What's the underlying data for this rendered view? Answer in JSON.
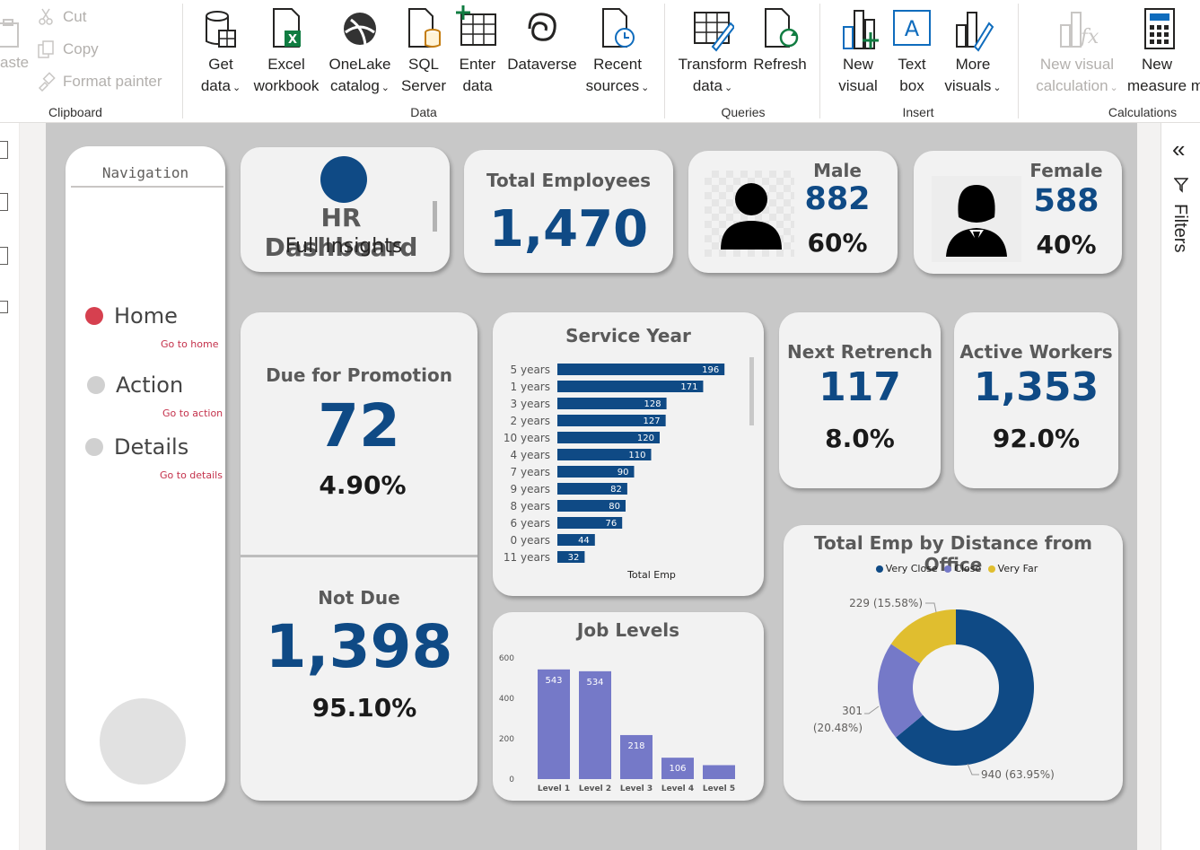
{
  "ribbon": {
    "clipboard": {
      "paste": "aste",
      "cut": "Cut",
      "copy": "Copy",
      "format_painter": "Format painter",
      "group": "Clipboard"
    },
    "data": {
      "group": "Data",
      "get_data": [
        "Get",
        "data"
      ],
      "excel": [
        "Excel",
        "workbook"
      ],
      "onelake": [
        "OneLake",
        "catalog"
      ],
      "sql": [
        "SQL",
        "Server"
      ],
      "enter": [
        "Enter",
        "data"
      ],
      "dataverse": "Dataverse",
      "recent": [
        "Recent",
        "sources"
      ]
    },
    "queries": {
      "group": "Queries",
      "transform": [
        "Transform",
        "data"
      ],
      "refresh": "Refresh"
    },
    "insert": {
      "group": "Insert",
      "new_visual": [
        "New",
        "visual"
      ],
      "text_box": [
        "Text",
        "box"
      ],
      "more_visuals": [
        "More",
        "visuals"
      ]
    },
    "calculations": {
      "group": "Calculations",
      "new_visual_calc": [
        "New visual",
        "calculation"
      ],
      "new_measure": [
        "New",
        "measure m"
      ]
    }
  },
  "filters_pane": {
    "collapse": "«",
    "label": "Filters"
  },
  "navigation": {
    "title": "Navigation",
    "items": [
      {
        "label": "Home",
        "sub": "Go to home"
      },
      {
        "label": "Action",
        "sub": "Go to action"
      },
      {
        "label": "Details",
        "sub": "Go to details"
      }
    ]
  },
  "header_card": {
    "title": "HR Dashboard",
    "subtitle": "Full Insights"
  },
  "total_employees": {
    "title": "Total Employees",
    "value": "1,470"
  },
  "male": {
    "title": "Male",
    "value": "882",
    "pct": "60%"
  },
  "female": {
    "title": "Female",
    "value": "588",
    "pct": "40%"
  },
  "promotion": {
    "title": "Due for Promotion",
    "value": "72",
    "pct": "4.90%"
  },
  "not_due": {
    "title": "Not Due",
    "value": "1,398",
    "pct": "95.10%"
  },
  "retrench": {
    "title": "Next Retrench",
    "value": "117",
    "pct": "8.0%"
  },
  "active": {
    "title": "Active Workers",
    "value": "1,353",
    "pct": "92.0%"
  },
  "colors": {
    "accent": "#0f4a85",
    "bar": "#0f4a85",
    "jobbar": "#7579c8",
    "very_close": "#0f4a85",
    "close": "#7579c8",
    "very_far": "#e0be2f",
    "nav_active": "#d6404f"
  },
  "chart_data": [
    {
      "type": "bar",
      "orientation": "horizontal",
      "title": "Service Year",
      "xlabel": "Total Emp",
      "categories": [
        "5 years",
        "1 years",
        "3 years",
        "2 years",
        "10 years",
        "4 years",
        "7 years",
        "9 years",
        "8 years",
        "6 years",
        "0 years",
        "11 years"
      ],
      "values": [
        196,
        171,
        128,
        127,
        120,
        110,
        90,
        82,
        80,
        76,
        44,
        32
      ],
      "xlim": [
        0,
        200
      ]
    },
    {
      "type": "bar",
      "title": "Job Levels",
      "categories": [
        "Level 1",
        "Level 2",
        "Level 3",
        "Level 4",
        "Level 5"
      ],
      "values": [
        543,
        534,
        218,
        106,
        69
      ],
      "data_labels": [
        "543",
        "534",
        "218",
        "106",
        ""
      ],
      "yticks": [
        "0",
        "200",
        "400",
        "600"
      ],
      "ylim": [
        0,
        600
      ]
    },
    {
      "type": "pie",
      "donut": true,
      "title": "Total Emp by Distance from Office",
      "legend": [
        "Very Close",
        "Close",
        "Very Far"
      ],
      "legend_position": "top",
      "values": [
        940,
        301,
        229
      ],
      "labels": [
        "940 (63.95%)",
        "301 (20.48%)",
        "229 (15.58%)"
      ],
      "label_lines": [
        [
          "940 (63.95%)"
        ],
        [
          "301",
          "(20.48%)"
        ],
        [
          "229 (15.58%)"
        ]
      ]
    }
  ]
}
